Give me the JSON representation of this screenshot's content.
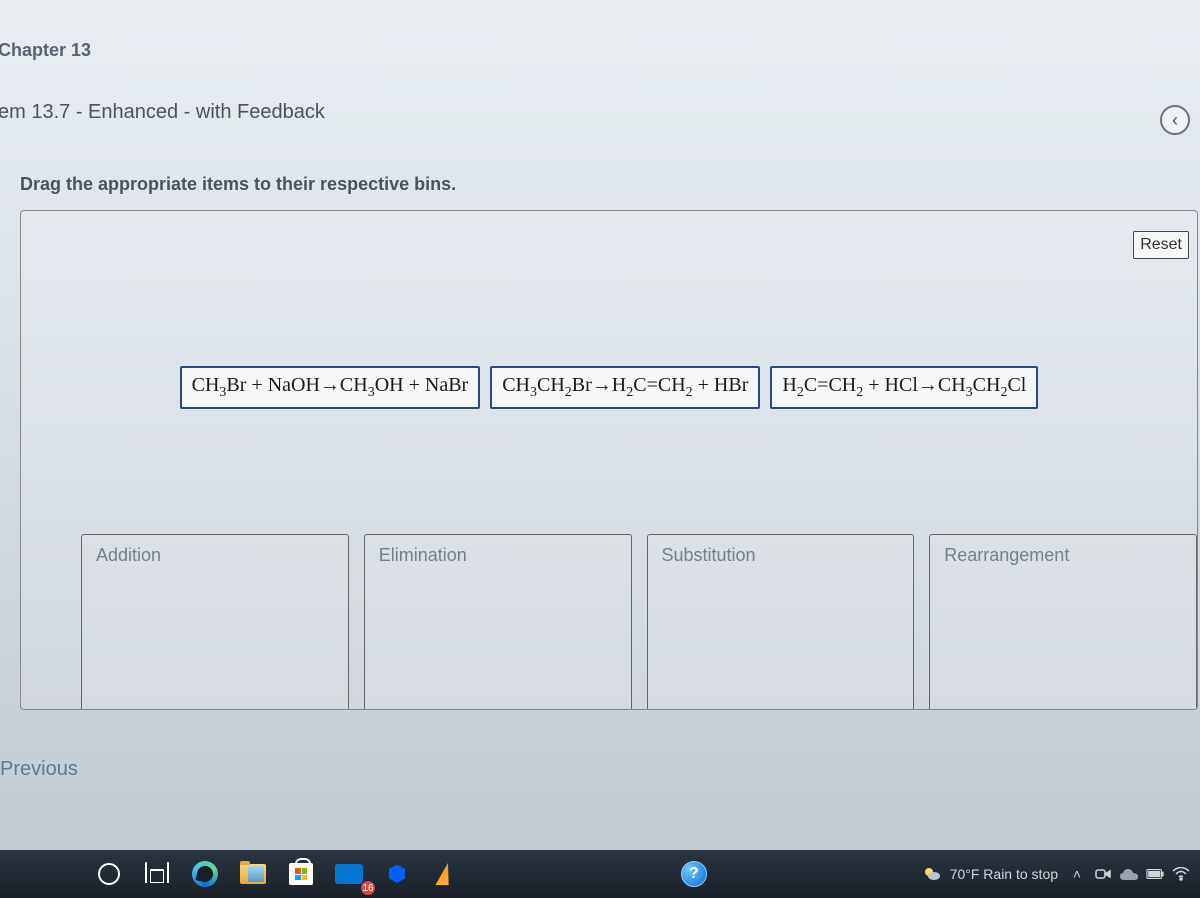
{
  "chapter_title": "Chapter 13",
  "problem_title": "em 13.7 - Enhanced - with Feedback",
  "back_arrow": "‹",
  "instruction": "Drag the appropriate items to their respective bins.",
  "reset_label": "Reset",
  "draggable_items": [
    {
      "html": "CH<sub>3</sub>Br + NaOH→CH<sub>3</sub>OH + NaBr"
    },
    {
      "html": "CH<sub>3</sub>CH<sub>2</sub>Br→H<sub>2</sub>C=CH<sub>2</sub> + HBr"
    },
    {
      "html": "H<sub>2</sub>C=CH<sub>2</sub> + HCl→CH<sub>3</sub>CH<sub>2</sub>Cl"
    }
  ],
  "bins": [
    {
      "label": "Addition"
    },
    {
      "label": "Elimination"
    },
    {
      "label": "Substitution"
    },
    {
      "label": "Rearrangement"
    }
  ],
  "previous_label": "Previous",
  "taskbar": {
    "mail_badge": "16",
    "weather_text": "70°F Rain to stop",
    "chevron": "˄"
  }
}
